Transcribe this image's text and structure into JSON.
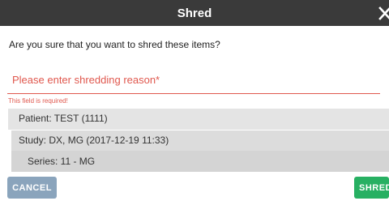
{
  "dialog": {
    "title": "Shred",
    "close_symbol": "X",
    "question": "Are you sure that you want to shred these items?",
    "reason_field": {
      "value": "",
      "placeholder": "Please enter shredding reason*",
      "error": "This field is required!"
    },
    "items": {
      "patient": "Patient: TEST (1111)",
      "study": "Study: DX, MG (2017-12-19 11:33)",
      "series": "Series: 11 - MG"
    },
    "buttons": {
      "cancel": "CANCEL",
      "shred": "SHRED"
    }
  },
  "colors": {
    "title_bar": "#3a3a3a",
    "error": "#e0584e",
    "cancel_button": "#8aa4bc",
    "shred_button": "#27b062"
  },
  "icons": {
    "close": "close-icon"
  }
}
